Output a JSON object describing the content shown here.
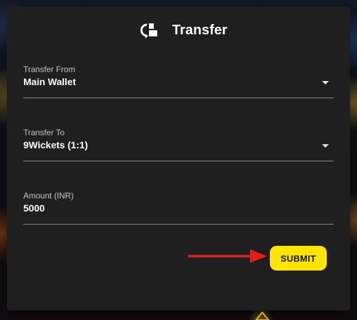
{
  "dialog": {
    "title": "Transfer",
    "icon": "transfer-icon"
  },
  "fields": {
    "transfer_from": {
      "label": "Transfer From",
      "value": "Main Wallet",
      "icon": "chevron-down-icon"
    },
    "transfer_to": {
      "label": "Transfer To",
      "value": "9Wickets (1:1)",
      "icon": "chevron-down-icon"
    },
    "amount": {
      "label": "Amount (INR)",
      "value": "5000"
    }
  },
  "submit": {
    "label": "SUBMIT"
  },
  "colors": {
    "dialog_bg": "#1f1f1f",
    "accent": "#ffe500",
    "annotation_arrow": "#e02020",
    "text": "#ffffff"
  }
}
